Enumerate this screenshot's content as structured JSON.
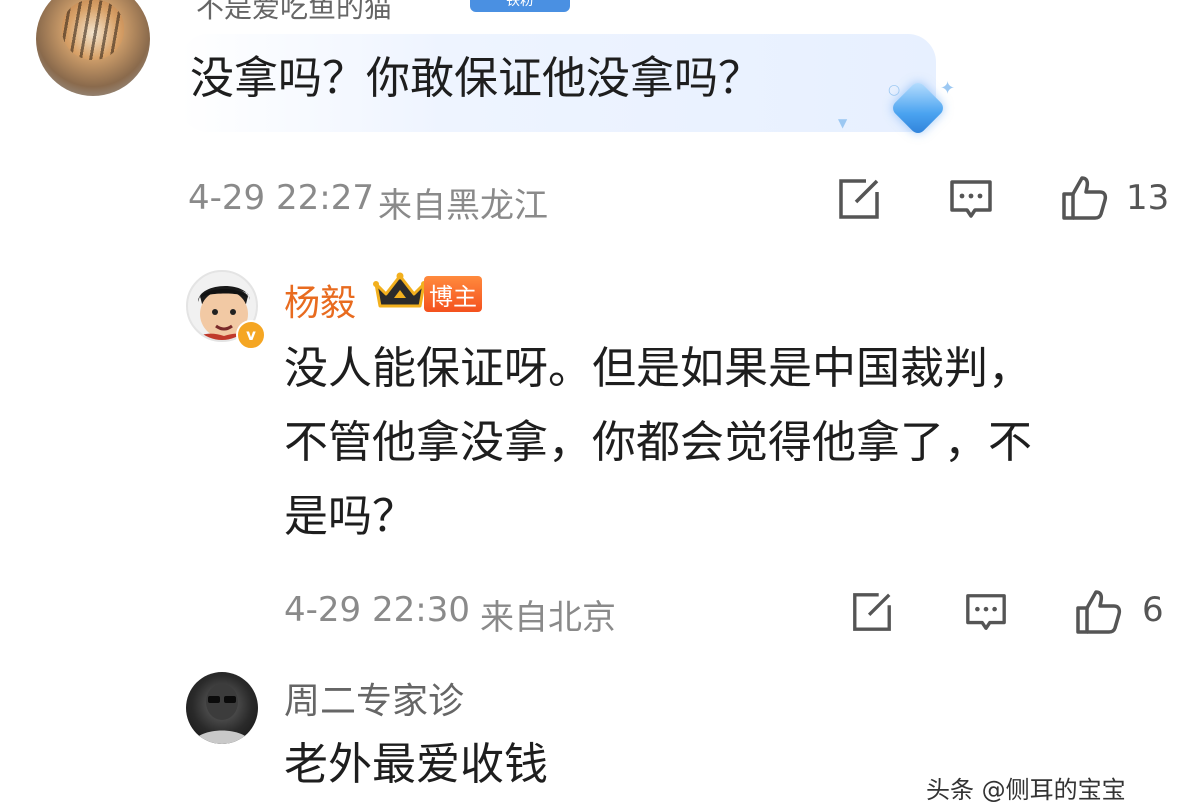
{
  "comment1": {
    "username": "不是爱吃鱼的猫",
    "badge": "铁粉",
    "text": "没拿吗？你敢保证他没拿吗？",
    "timestamp": "4-29 22:27",
    "location": "来自黑龙江",
    "like_count": "13"
  },
  "comment2": {
    "username": "杨毅",
    "verified_mark": "v",
    "role_badge": "博主",
    "text_lines": [
      "没人能保证呀。但是如果是中国裁判，",
      "不管他拿没拿，你都会觉得他拿了，不",
      "是吗？"
    ],
    "timestamp": "4-29 22:30",
    "location": "来自北京",
    "like_count": "6"
  },
  "comment3": {
    "username": "周二专家诊",
    "text": "老外最爱收钱"
  },
  "watermark": "头条 @侧耳的宝宝",
  "colors": {
    "accent_orange": "#e86b1f",
    "meta_gray": "#8a8a8a",
    "bubble_blue": "#e7f0ff"
  },
  "icons": [
    "share-icon",
    "comment-icon",
    "like-icon"
  ]
}
